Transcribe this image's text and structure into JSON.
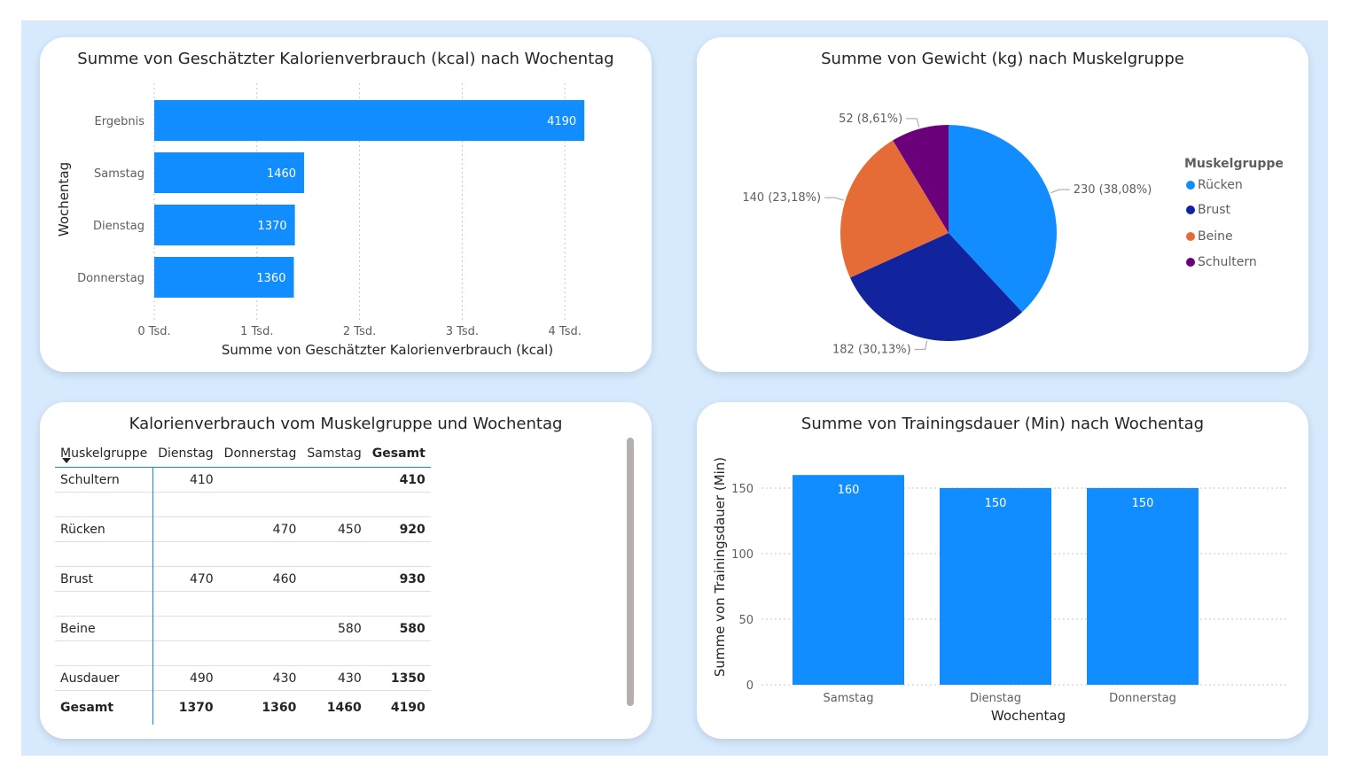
{
  "colors": {
    "bar": "#118dff",
    "rücken": "#118dff",
    "brust": "#12239e",
    "beine": "#e66c37",
    "schultern": "#6b007b"
  },
  "charts": {
    "calories": {
      "title": "Summe von Geschätzter Kalorienverbrauch (kcal) nach Wochentag",
      "xlabel": "Summe von Geschätzter Kalorienverbrauch (kcal)",
      "ylabel": "Wochentag",
      "ticks": [
        "0 Tsd.",
        "1 Tsd.",
        "2 Tsd.",
        "3 Tsd.",
        "4 Tsd."
      ]
    },
    "weight": {
      "title": "Summe von Gewicht (kg) nach Muskelgruppe",
      "legend_title": "Muskelgruppe",
      "slice_labels": [
        "230 (38,08%)",
        "182 (30,13%)",
        "140 (23,18%)",
        "52 (8,61%)"
      ]
    },
    "matrix": {
      "title": "Kalorienverbrauch vom Muskelgruppe und Wochentag",
      "headers": [
        "Muskelgruppe",
        "Dienstag",
        "Donnerstag",
        "Samstag",
        "Gesamt"
      ],
      "rows": [
        [
          "Schultern",
          "410",
          "",
          "",
          "410"
        ],
        [
          "Rücken",
          "",
          "470",
          "450",
          "920"
        ],
        [
          "Brust",
          "470",
          "460",
          "",
          "930"
        ],
        [
          "Beine",
          "",
          "",
          "580",
          "580"
        ],
        [
          "Ausdauer",
          "490",
          "430",
          "430",
          "1350"
        ]
      ],
      "total": [
        "Gesamt",
        "1370",
        "1360",
        "1460",
        "4190"
      ]
    },
    "duration": {
      "title": "Summe von Trainingsdauer (Min) nach Wochentag",
      "xlabel": "Wochentag",
      "ylabel": "Summe von Trainingsdauer (Min)",
      "ticks": [
        "0",
        "50",
        "100",
        "150"
      ]
    }
  },
  "chart_data": [
    {
      "type": "bar",
      "orientation": "horizontal",
      "title": "Summe von Geschätzter Kalorienverbrauch (kcal) nach Wochentag",
      "xlabel": "Summe von Geschätzter Kalorienverbrauch (kcal)",
      "ylabel": "Wochentag",
      "categories": [
        "Ergebnis",
        "Samstag",
        "Dienstag",
        "Donnerstag"
      ],
      "values": [
        4190,
        1460,
        1370,
        1360
      ],
      "xlim": [
        0,
        4300
      ],
      "grid": true
    },
    {
      "type": "pie",
      "title": "Summe von Gewicht (kg) nach Muskelgruppe",
      "legend_title": "Muskelgruppe",
      "legend_position": "right",
      "categories": [
        "Rücken",
        "Brust",
        "Beine",
        "Schultern"
      ],
      "values": [
        230,
        182,
        140,
        52
      ]
    },
    {
      "type": "table",
      "title": "Kalorienverbrauch vom Muskelgruppe und Wochentag",
      "headers": [
        "Muskelgruppe",
        "Dienstag",
        "Donnerstag",
        "Samstag",
        "Gesamt"
      ],
      "rows": [
        [
          "Schultern",
          "410",
          "",
          "",
          "410"
        ],
        [
          "Rücken",
          "",
          "470",
          "450",
          "920"
        ],
        [
          "Brust",
          "470",
          "460",
          "",
          "930"
        ],
        [
          "Beine",
          "",
          "",
          "580",
          "580"
        ],
        [
          "Ausdauer",
          "490",
          "430",
          "430",
          "1350"
        ],
        [
          "Gesamt",
          "1370",
          "1360",
          "1460",
          "4190"
        ]
      ]
    },
    {
      "type": "bar",
      "orientation": "vertical",
      "title": "Summe von Trainingsdauer (Min) nach Wochentag",
      "xlabel": "Wochentag",
      "ylabel": "Summe von Trainingsdauer (Min)",
      "categories": [
        "Samstag",
        "Dienstag",
        "Donnerstag"
      ],
      "values": [
        160,
        150,
        150
      ],
      "ylim": [
        0,
        165
      ],
      "grid": true
    }
  ]
}
